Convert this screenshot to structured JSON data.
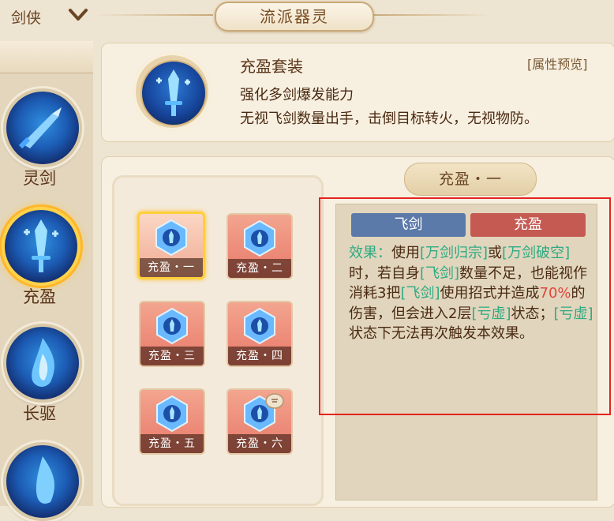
{
  "header": {
    "title": "流派器灵"
  },
  "sidebar": {
    "dropdown_label": "剑侠",
    "items": [
      {
        "label": "灵剑"
      },
      {
        "label": "充盈"
      },
      {
        "label": "长驱"
      }
    ]
  },
  "set": {
    "title": "充盈套装",
    "attr_link": "[属性预览]",
    "desc1": "强化多剑爆发能力",
    "desc2": "无视飞剑数量出手，击倒目标转火，无视物防。"
  },
  "grid": {
    "cells": [
      "充盈・一",
      "充盈・二",
      "充盈・三",
      "充盈・四",
      "充盈・五",
      "充盈・六"
    ]
  },
  "detail": {
    "title": "充盈・一",
    "tag_left": "飞剑",
    "tag_right": "充盈",
    "effect": {
      "p1": "效果：",
      "p2": "使用",
      "p3": "[万剑归宗]",
      "p4": "或",
      "p5": "[万剑破空]",
      "p6": "时，若自身",
      "p7": "[飞剑]",
      "p8": "数量不足，也能视作消耗3把",
      "p9": "[飞剑]",
      "p10": "使用招式并造成",
      "p11": "70%",
      "p12": "的伤害，但会进入2层",
      "p13": "[亏虚]",
      "p14": "状态；",
      "p15": "[亏虚]",
      "p16": "状态下无法再次触发本效果。"
    }
  },
  "colors": {
    "accent_green": "#2eaa82",
    "accent_red": "#e0463c",
    "tag_blue": "#5b79a9",
    "tag_red": "#c55a52"
  }
}
